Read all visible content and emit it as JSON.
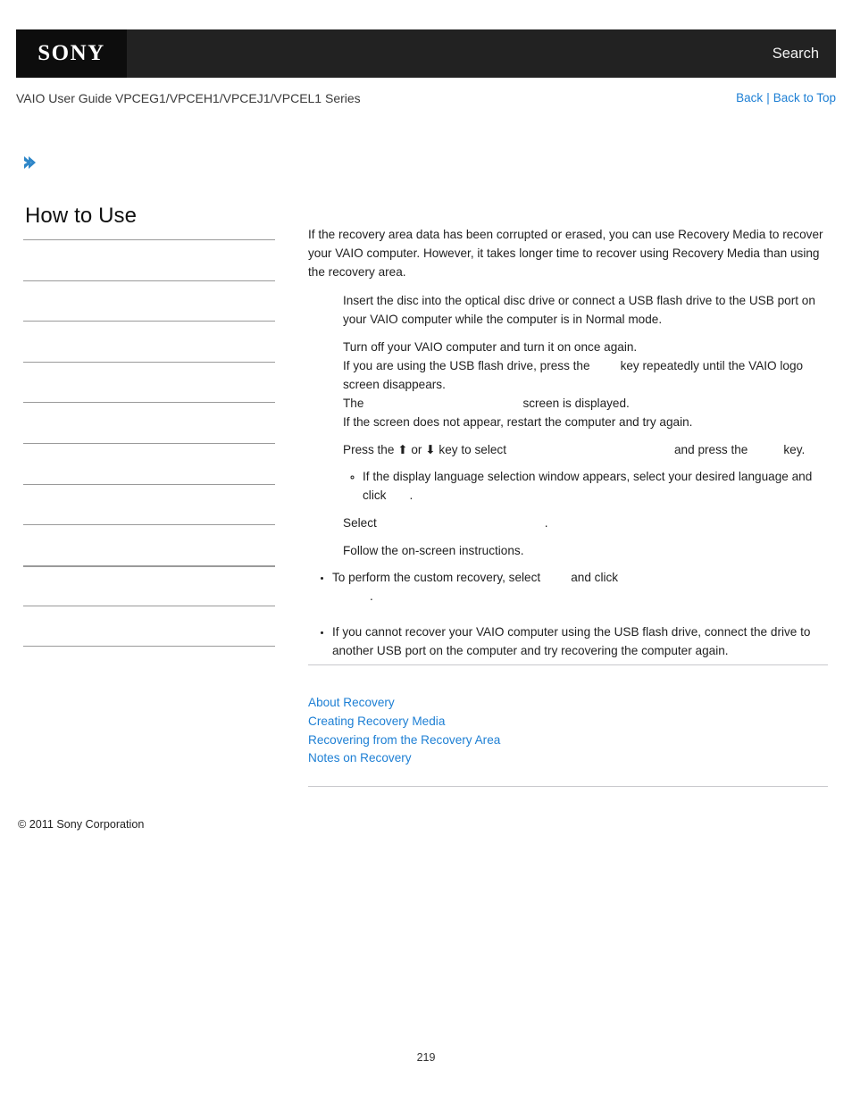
{
  "header": {
    "logo_text": "SONY",
    "search_label": "Search",
    "guide_title": "VAIO User Guide VPCEG1/VPCEH1/VPCEJ1/VPCEL1 Series",
    "back_label": "Back",
    "separator": "|",
    "back_to_top_label": "Back to Top"
  },
  "breadcrumb": {
    "chevron_icon": "chevron-right-icon",
    "text": ""
  },
  "sidebar": {
    "title": "How to Use",
    "items": [
      {
        "label": ""
      },
      {
        "label": ""
      },
      {
        "label": ""
      },
      {
        "label": ""
      },
      {
        "label": ""
      },
      {
        "label": ""
      },
      {
        "label": ""
      },
      {
        "label": ""
      },
      {
        "label": ""
      },
      {
        "label": ""
      }
    ]
  },
  "main": {
    "intro": "If the recovery area data has been corrupted or erased, you can use Recovery Media to recover your VAIO computer. However, it takes longer time to recover using Recovery Media than using the recovery area.",
    "steps": [
      {
        "text_before": "Insert the disc into the optical disc drive or connect a USB flash drive to the USB port on your VAIO computer while the computer is in Normal mode.",
        "text_after": ""
      },
      {
        "line1": "Turn off your VAIO computer and turn it on once again.",
        "line2_before": "If you are using the USB flash drive, press the",
        "line2_after": "key repeatedly until the VAIO logo screen disappears.",
        "line3_before": "The",
        "line3_after": "screen is displayed.",
        "line4": "If the screen does not appear, restart the computer and try again."
      },
      {
        "line1_before": "Press the",
        "arrow_up": "⬆",
        "line1_mid_or": "or",
        "arrow_down": "⬇",
        "line1_mid": "key to select",
        "line1_after_and": "and press the",
        "line1_end": "key.",
        "subnote": {
          "text_before": "If the display language selection window appears, select your desired language and click",
          "text_after": "."
        }
      },
      {
        "text_before": "Select",
        "text_after": "."
      },
      {
        "text": "Follow the on-screen instructions."
      }
    ],
    "notes": [
      {
        "before": "To perform the custom recovery, select",
        "middle": "and click",
        "after": "."
      },
      {
        "text": "If you cannot recover your VAIO computer using the USB flash drive, connect the drive to another USB port on the computer and try recovering the computer again."
      }
    ],
    "related_links": [
      "About Recovery",
      "Creating Recovery Media",
      "Recovering from the Recovery Area",
      "Notes on Recovery"
    ]
  },
  "footer": {
    "copyright": "© 2011 Sony Corporation",
    "page_number": "219"
  },
  "colors": {
    "link": "#1d7fd4",
    "topbar": "#222222",
    "logo_box": "#0d0d0d",
    "rule": "#c8c8cc",
    "sidebar_rule": "#9a9a9a"
  }
}
